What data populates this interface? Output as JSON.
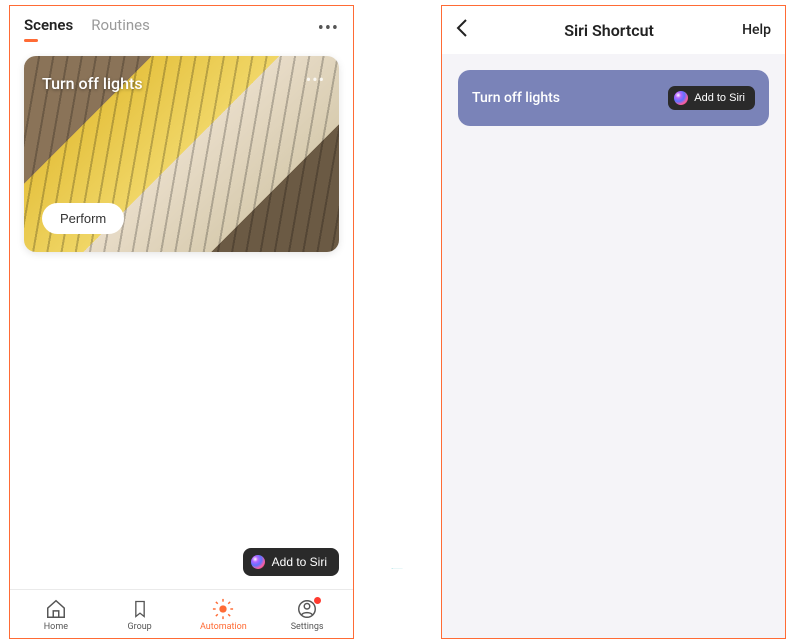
{
  "left": {
    "tabs": [
      {
        "label": "Scenes",
        "active": true
      },
      {
        "label": "Routines",
        "active": false
      }
    ],
    "scene": {
      "title": "Turn off lights",
      "perform_label": "Perform"
    },
    "add_to_siri_label": "Add to Siri",
    "nav": [
      {
        "label": "Home",
        "icon": "home",
        "active": false,
        "badge": false
      },
      {
        "label": "Group",
        "icon": "bookmark",
        "active": false,
        "badge": false
      },
      {
        "label": "Automation",
        "icon": "sun",
        "active": true,
        "badge": false
      },
      {
        "label": "Settings",
        "icon": "person",
        "active": false,
        "badge": true
      }
    ]
  },
  "right": {
    "title": "Siri Shortcut",
    "help_label": "Help",
    "shortcut": {
      "label": "Turn off lights",
      "add_label": "Add to Siri"
    }
  }
}
